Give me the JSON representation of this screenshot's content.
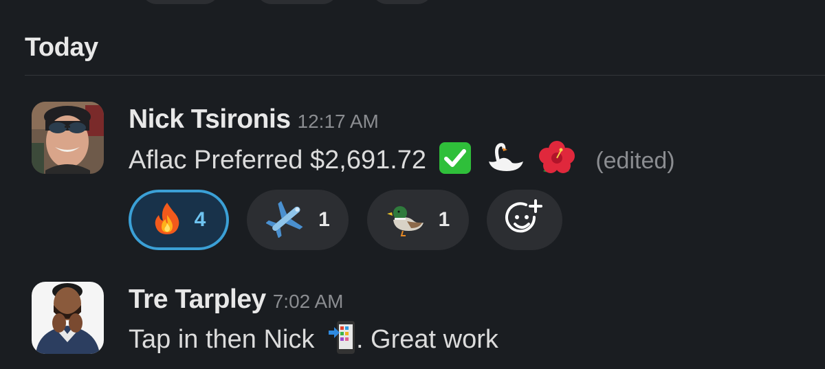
{
  "day_divider": {
    "label": "Today"
  },
  "messages": [
    {
      "author": "Nick Tsironis",
      "time": "12:17 AM",
      "text": "Aflac Preferred $2,691.72",
      "emojis": [
        "check-mark-emoji",
        "swan-emoji",
        "hibiscus-emoji"
      ],
      "edited": "(edited)",
      "reactions": [
        {
          "emoji": "fire-emoji",
          "count": "4",
          "reacted_by_me": true
        },
        {
          "emoji": "airplane-emoji",
          "count": "1",
          "reacted_by_me": false
        },
        {
          "emoji": "duck-emoji",
          "count": "1",
          "reacted_by_me": false
        }
      ],
      "add_reaction_icon": "add-reaction-icon"
    },
    {
      "author": "Tre Tarpley",
      "time": "7:02 AM",
      "text": "Tap in then Nick",
      "emoji": "phone-with-arrow-emoji",
      "text_after": ". Great work"
    }
  ],
  "colors": {
    "background": "#1a1d21",
    "reaction_bg": "#2c2e32",
    "active_reaction_border": "#3ba0d6",
    "active_reaction_count": "#6ec3f0",
    "muted_text": "#8b8d91"
  }
}
